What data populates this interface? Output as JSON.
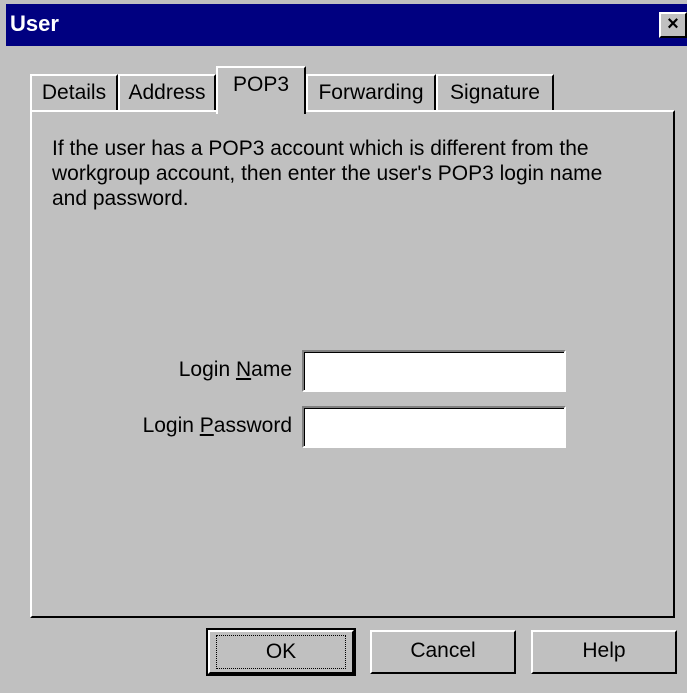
{
  "window": {
    "title": "User",
    "close_label": "×"
  },
  "tabs": [
    {
      "label": "Details"
    },
    {
      "label": "Address"
    },
    {
      "label": "POP3"
    },
    {
      "label": "Forwarding"
    },
    {
      "label": "Signature"
    }
  ],
  "active_tab": "POP3",
  "pop3": {
    "description": "If the user has a POP3 account which is different from the workgroup account, then enter the user's POP3 login name and password.",
    "login_name": {
      "label_prefix": "Login ",
      "label_accel": "N",
      "label_suffix": "ame",
      "value": ""
    },
    "login_password": {
      "label_prefix": "Login ",
      "label_accel": "P",
      "label_suffix": "assword",
      "value": ""
    }
  },
  "buttons": {
    "ok": "OK",
    "cancel": "Cancel",
    "help": "Help"
  }
}
